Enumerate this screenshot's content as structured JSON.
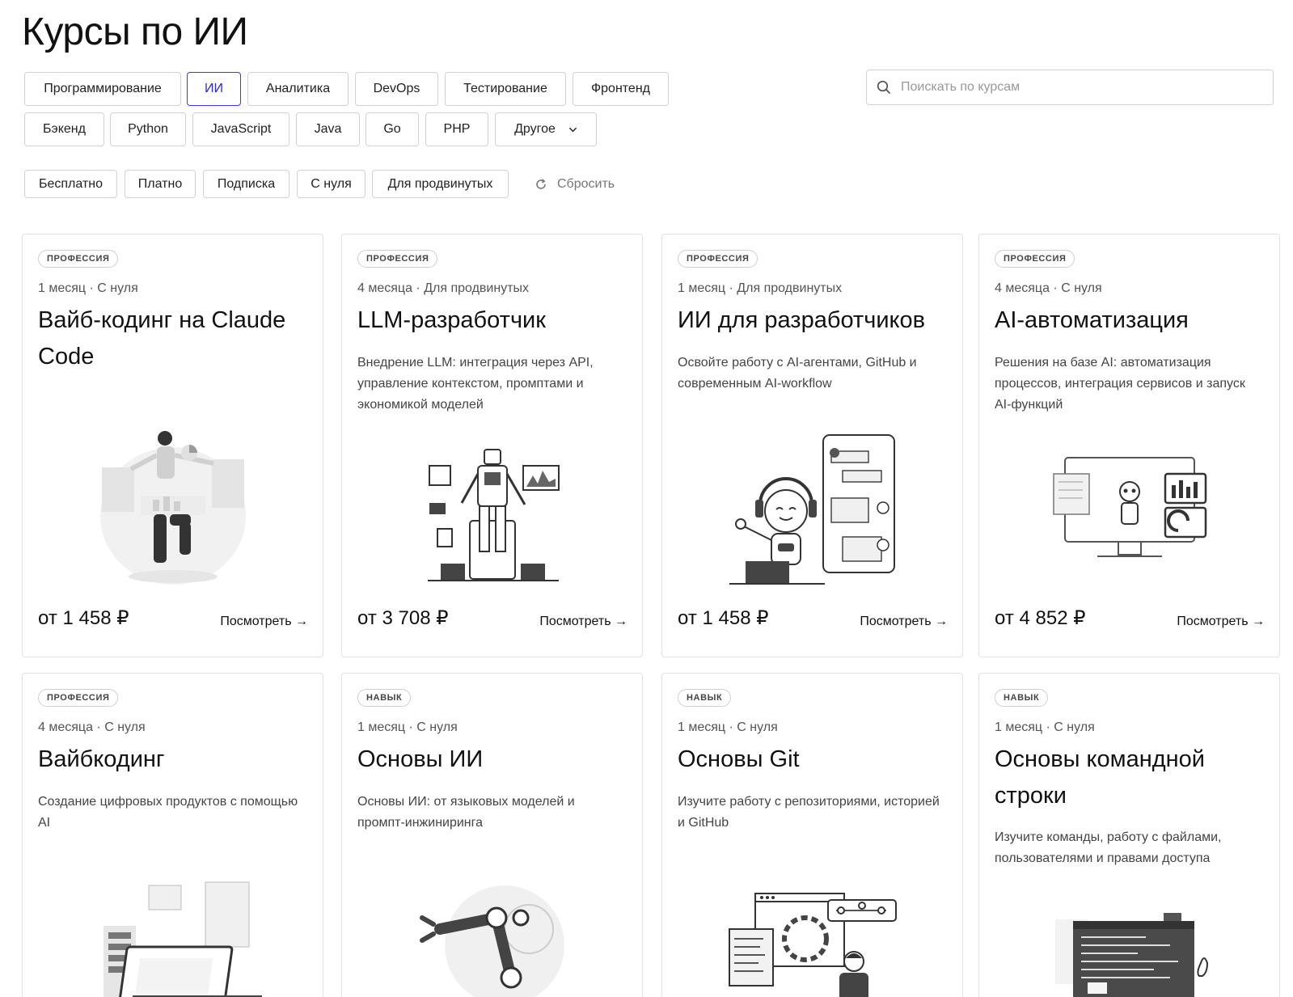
{
  "page": {
    "title": "Курсы по ИИ"
  },
  "categories": [
    "Программирование",
    "ИИ",
    "Аналитика",
    "DevOps",
    "Тестирование",
    "Фронтенд",
    "Бэкенд",
    "Python",
    "JavaScript",
    "Java",
    "Go",
    "PHP",
    "Другое"
  ],
  "active_category": "ИИ",
  "filters": [
    "Бесплатно",
    "Платно",
    "Подписка",
    "С нуля",
    "Для продвинутых"
  ],
  "reset_label": "Сбросить",
  "search": {
    "placeholder": "Поискать по курсам",
    "value": ""
  },
  "view_label": "Посмотреть →",
  "cards": [
    {
      "badge": "ПРОФЕССИЯ",
      "meta": "1 месяц · С нуля",
      "title": "Вайб-кодинг на Claude Code",
      "desc": "",
      "price": "от 1 458 ₽",
      "art": "person-charts-icon"
    },
    {
      "badge": "ПРОФЕССИЯ",
      "meta": "4 месяца · Для продвинутых",
      "title": "LLM-разработчик",
      "desc": "Внедрение LLM: интеграция через API, управление контекстом, промптами и экономикой моделей",
      "price": "от 3 708 ₽",
      "art": "robot-throne-icon"
    },
    {
      "badge": "ПРОФЕССИЯ",
      "meta": "1 месяц · Для продвинутых",
      "title": "ИИ для разработчиков",
      "desc": "Освойте работу с AI-агентами, GitHub и современным AI-workflow",
      "price": "от 1 458 ₽",
      "art": "robot-chat-icon"
    },
    {
      "badge": "ПРОФЕССИЯ",
      "meta": "4 месяца · С нуля",
      "title": "AI-автоматизация",
      "desc": "Решения на базе AI: автоматизация процессов, интеграция сервисов и запуск AI-функций",
      "price": "от 4 852 ₽",
      "art": "monitor-dashboard-icon"
    },
    {
      "badge": "ПРОФЕССИЯ",
      "meta": "4 месяца · С нуля",
      "title": "Вайбкодинг",
      "desc": "Создание цифровых продуктов с помощью AI",
      "price": "",
      "art": "laptop-servers-icon"
    },
    {
      "badge": "НАВЫК",
      "meta": "1 месяц · С нуля",
      "title": "Основы ИИ",
      "desc": "Основы ИИ: от языковых моделей и промпт-инжиниринга",
      "price": "",
      "art": "robot-arm-icon"
    },
    {
      "badge": "НАВЫК",
      "meta": "1 месяц · С нуля",
      "title": "Основы Git",
      "desc": "Изучите работу с репозиториями, историей и GitHub",
      "price": "",
      "art": "git-workflow-icon"
    },
    {
      "badge": "НАВЫК",
      "meta": "1 месяц · С нуля",
      "title": "Основы командной строки",
      "desc": "Изучите команды, работу с файлами, пользователями и правами доступа",
      "price": "",
      "art": "terminal-window-icon"
    }
  ]
}
